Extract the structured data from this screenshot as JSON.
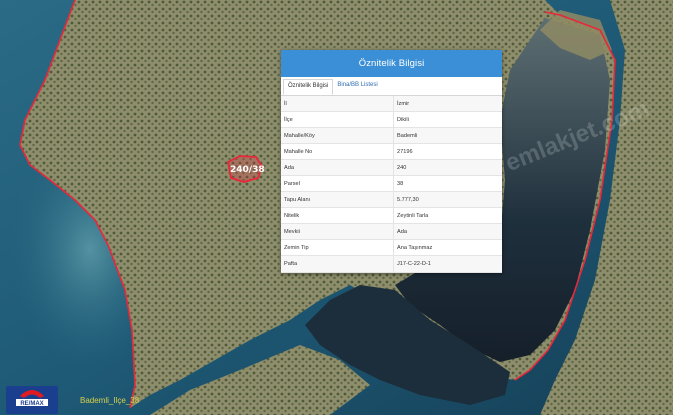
{
  "panel": {
    "title": "Öznitelik Bilgisi",
    "tabs": [
      "Öznitelik Bilgisi",
      "Bina/BB Listesi"
    ],
    "rows": [
      {
        "key": "İl",
        "value": "İzmir"
      },
      {
        "key": "İlçe",
        "value": "Dikili"
      },
      {
        "key": "Mahalle/Köy",
        "value": "Bademli"
      },
      {
        "key": "Mahalle No",
        "value": "27196"
      },
      {
        "key": "Ada",
        "value": "240"
      },
      {
        "key": "Parsel",
        "value": "38"
      },
      {
        "key": "Tapu Alanı",
        "value": "5.777,30"
      },
      {
        "key": "Nitelik",
        "value": "Zeytinli Tarla"
      },
      {
        "key": "Mevkii",
        "value": "Ada"
      },
      {
        "key": "Zemin Tip",
        "value": "Ana Taşınmaz"
      },
      {
        "key": "Pafta",
        "value": "J17-C-22-D-1"
      }
    ]
  },
  "map": {
    "parcel_label": "240/38",
    "boundary_color": "#e8283a",
    "sea_color": "#1f5a78",
    "land_color": "#8a8b6a"
  },
  "overlay": {
    "logo_text": "RE/MAX",
    "caption": "Bademli_Ilçe_38",
    "watermark": "sahibinden / emlakjet.com"
  }
}
